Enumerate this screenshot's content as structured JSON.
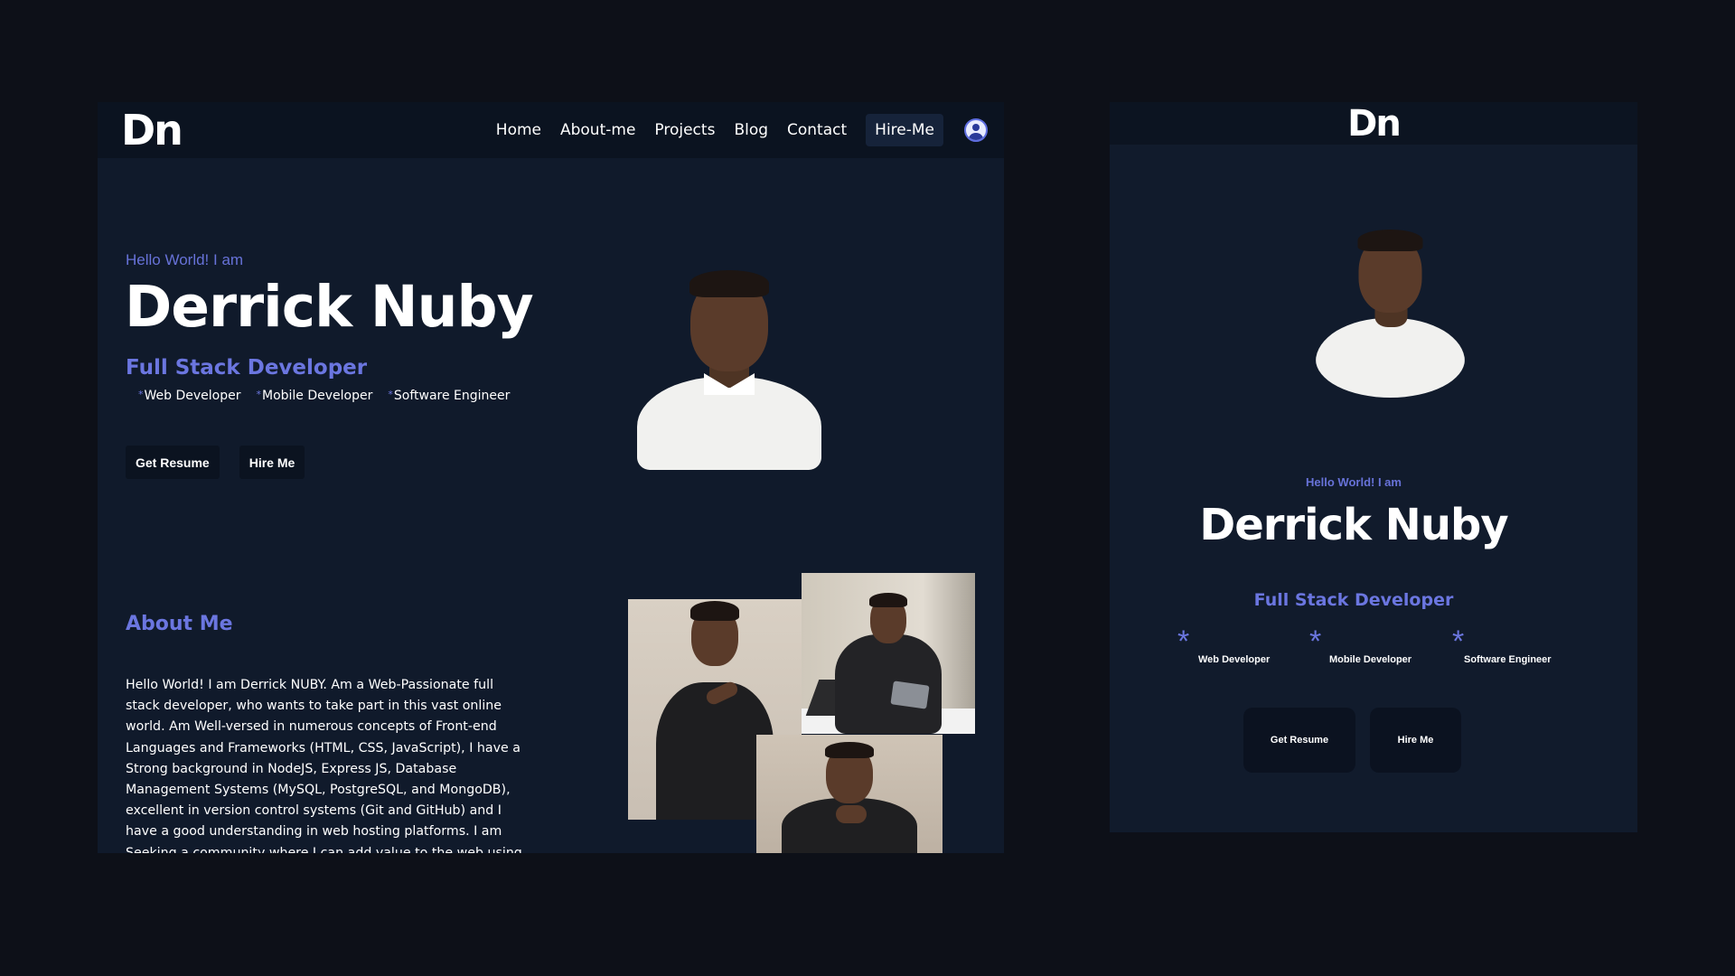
{
  "brand": {
    "logo": "Dn"
  },
  "desktop": {
    "nav": {
      "items": [
        "Home",
        "About-me",
        "Projects",
        "Blog",
        "Contact"
      ],
      "hire_label": "Hire-Me",
      "profile_icon": "user-circle-icon"
    },
    "hero": {
      "greeting": "Hello World! I am",
      "name": "Derrick Nuby",
      "role": "Full Stack Developer",
      "skills": [
        "Web Developer",
        "Mobile Developer",
        "Software Engineer"
      ],
      "buttons": {
        "resume": "Get Resume",
        "hire": "Hire Me"
      }
    },
    "about": {
      "title": "About Me",
      "text": "Hello World! I am Derrick NUBY. Am a Web-Passionate full stack developer, who wants to take part in this vast online world. Am Well-versed in numerous concepts of Front-end Languages and Frameworks (HTML, CSS, JavaScript), I have a Strong background in NodeJS, Express JS, Database Management Systems (MySQL, PostgreSQL, and MongoDB), excellent in version control systems (Git and GitHub) and I have a good understanding in web hosting platforms. I am Seeking a community where I can add value to the web using my skills by building softwares that solve real world"
    }
  },
  "mobile": {
    "greeting": "Hello World! I am",
    "name": "Derrick Nuby",
    "role": "Full Stack Developer",
    "skills": [
      "Web Developer",
      "Mobile Developer",
      "Software Engineer"
    ],
    "buttons": {
      "resume": "Get Resume",
      "hire": "Hire Me"
    }
  },
  "colors": {
    "page_bg": "#0d1018",
    "panel_bg": "#101a2b",
    "nav_bg": "#0b1320",
    "accent": "#6b76e0",
    "text": "#ffffff"
  }
}
